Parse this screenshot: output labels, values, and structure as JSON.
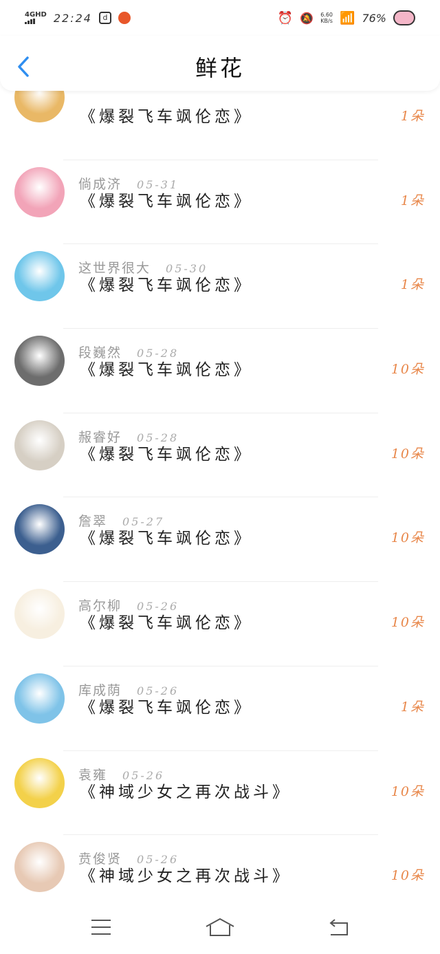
{
  "status_bar": {
    "network": "4GHD",
    "time": "22:24",
    "speed": "6.60\nKB/s",
    "battery": "76%"
  },
  "header": {
    "title": "鲜花"
  },
  "rows": [
    {
      "name": "",
      "date": "",
      "book": "《爆裂飞车飒伦恋》",
      "amount": "1朵",
      "avatar_color": "#e9b866"
    },
    {
      "name": "倘成济",
      "date": "05-31",
      "book": "《爆裂飞车飒伦恋》",
      "amount": "1朵",
      "avatar_color": "#f2a4b8"
    },
    {
      "name": "这世界很大",
      "date": "05-30",
      "book": "《爆裂飞车飒伦恋》",
      "amount": "1朵",
      "avatar_color": "#6fc6ea"
    },
    {
      "name": "段巍然",
      "date": "05-28",
      "book": "《爆裂飞车飒伦恋》",
      "amount": "10朵",
      "avatar_color": "#6d6d6d"
    },
    {
      "name": "赧睿好",
      "date": "05-28",
      "book": "《爆裂飞车飒伦恋》",
      "amount": "10朵",
      "avatar_color": "#d6cfc4"
    },
    {
      "name": "詹翠",
      "date": "05-27",
      "book": "《爆裂飞车飒伦恋》",
      "amount": "10朵",
      "avatar_color": "#3c5f8f"
    },
    {
      "name": "高尔柳",
      "date": "05-26",
      "book": "《爆裂飞车飒伦恋》",
      "amount": "10朵",
      "avatar_color": "#f7efe0"
    },
    {
      "name": "库成荫",
      "date": "05-26",
      "book": "《爆裂飞车飒伦恋》",
      "amount": "1朵",
      "avatar_color": "#7fc3e8"
    },
    {
      "name": "袁雍",
      "date": "05-26",
      "book": "《神域少女之再次战斗》",
      "amount": "10朵",
      "avatar_color": "#f3d14a"
    },
    {
      "name": "贲俊贤",
      "date": "05-26",
      "book": "《神域少女之再次战斗》",
      "amount": "10朵",
      "avatar_color": "#e7c9b4"
    }
  ],
  "nav": {
    "menu_icon": "menu-icon",
    "home_icon": "home-icon",
    "back_icon": "back-icon"
  },
  "colors": {
    "accent": "#e8874a",
    "back_arrow": "#2f8ef0"
  }
}
